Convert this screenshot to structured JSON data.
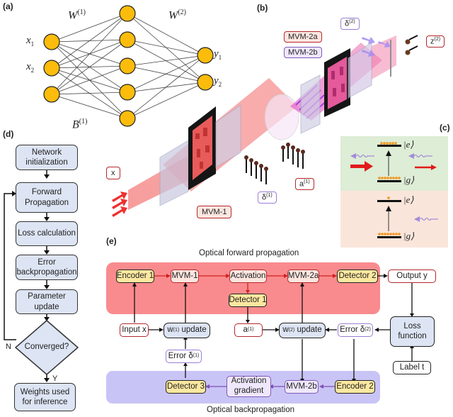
{
  "panels": {
    "a": "(a)",
    "b": "(b)",
    "c": "(c)",
    "d": "(d)",
    "e": "(e)"
  },
  "panel_a": {
    "weight1": "W",
    "weight1_sup": "(1)",
    "weight2": "W",
    "weight2_sup": "(2)",
    "bias": "B",
    "bias_sup": "(1)",
    "inputs": [
      "x",
      "x"
    ],
    "input_subs": [
      "1",
      "2"
    ],
    "outputs": [
      "y",
      "y"
    ],
    "output_subs": [
      "1",
      "2"
    ],
    "layers": [
      3,
      5,
      2
    ],
    "node_color": "#fbbc0c"
  },
  "panel_b": {
    "x_label": "x",
    "mvm1": "MVM-1",
    "mvm2a": "MVM-2a",
    "mvm2b": "MVM-2b",
    "delta1": "δ",
    "delta1_sup": "(1)",
    "delta2": "δ",
    "delta2_sup": "(2)",
    "a1": "a",
    "a1_sup": "(1)",
    "z2": "z",
    "z2_sup": "(2)"
  },
  "panel_c": {
    "excited": "|e⟩",
    "ground": "|g⟩",
    "top_bg": "#ddedd6",
    "bottom_bg": "#fae5da"
  },
  "panel_d": {
    "steps": [
      "Network initialization",
      "Forward Propagation",
      "Loss calculation",
      "Error backpropagation",
      "Parameter update"
    ],
    "decision": "Converged?",
    "no_label": "N",
    "yes_label": "Y",
    "final": "Weights used for inference"
  },
  "panel_e": {
    "forward_title": "Optical forward propagation",
    "backward_title": "Optical backpropagation",
    "encoder1": "Encoder 1",
    "mvm1": "MVM-1",
    "activation": "Activation",
    "mvm2a": "MVM-2a",
    "detector2": "Detector 2",
    "output": "Output y",
    "detector1": "Detector 1",
    "input": "Input x",
    "w1_update": "w",
    "w1_sup": "(1)",
    "w_update_suffix": " update",
    "a1": "a",
    "a1_sup": "(1)",
    "w2_update": "w",
    "w2_sup": "(2)",
    "error2": "Error δ",
    "error2_sup": "(2)",
    "loss": "Loss function",
    "label": "Label t",
    "error1": "Error δ",
    "error1_sup": "(1)",
    "detector3": "Detector 3",
    "act_gradient": "Activation gradient",
    "mvm2b": "MVM-2b",
    "encoder2": "Encoder 2",
    "forward_bg": "#f98b8e",
    "backward_bg": "#c9c4f6"
  }
}
